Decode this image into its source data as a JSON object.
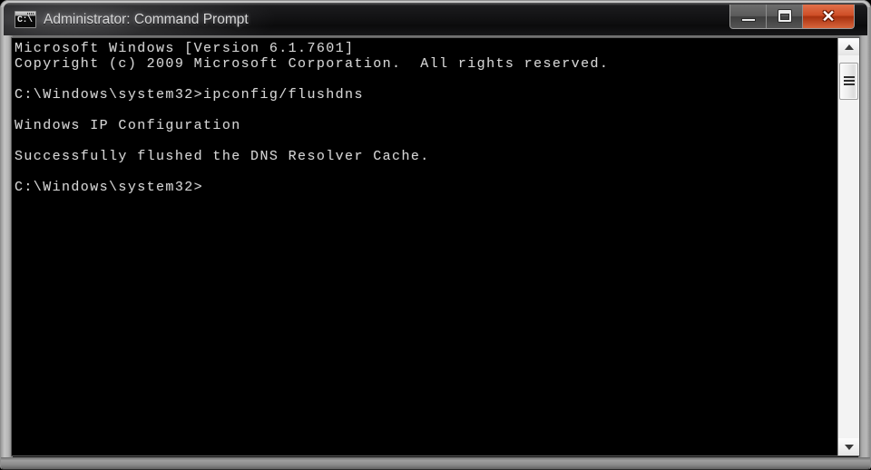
{
  "window": {
    "title": "Administrator: Command Prompt",
    "icon_name": "command-prompt-icon",
    "icon_text": "C:\\",
    "buttons": {
      "minimize_label": "–",
      "maximize_label": "□",
      "close_label": "✕"
    },
    "colors": {
      "titlebar": "#141416",
      "frame": "#9a9a9a",
      "console_background": "#000000",
      "console_text": "#d5d5d5",
      "close_button": "#cf4f27"
    }
  },
  "console": {
    "lines": [
      "Microsoft Windows [Version 6.1.7601]",
      "Copyright (c) 2009 Microsoft Corporation.  All rights reserved.",
      "",
      "C:\\Windows\\system32>ipconfig/flushdns",
      "",
      "Windows IP Configuration",
      "",
      "Successfully flushed the DNS Resolver Cache.",
      "",
      "C:\\Windows\\system32>"
    ]
  },
  "scrollbar": {
    "up_arrow": "▲",
    "down_arrow": "▼",
    "thumb_position_percent": 2
  }
}
